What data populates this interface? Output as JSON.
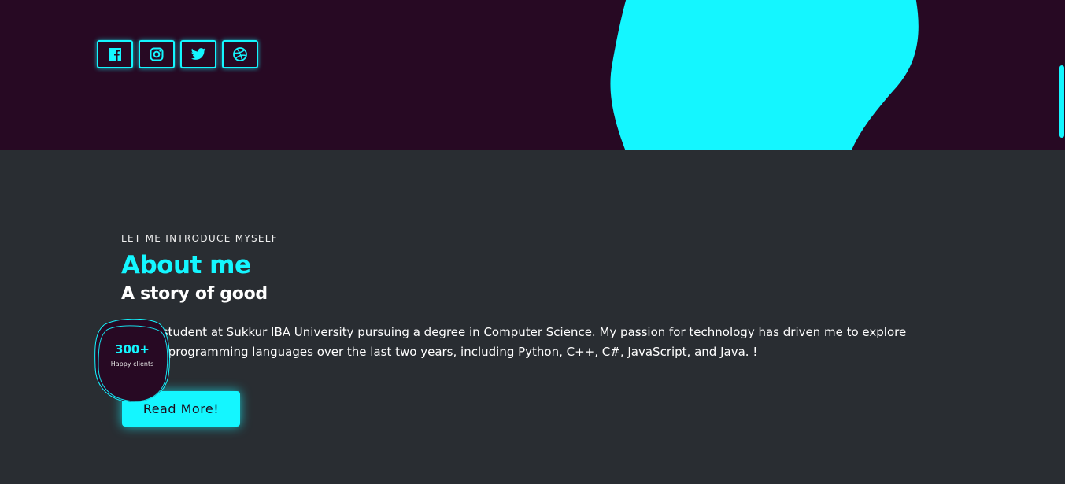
{
  "colors": {
    "accent": "#14f6ff",
    "hero_bg": "#270923",
    "section_bg": "#292d32"
  },
  "hero": {
    "socials": [
      {
        "name": "facebook-icon"
      },
      {
        "name": "instagram-icon"
      },
      {
        "name": "twitter-icon"
      },
      {
        "name": "dribbble-icon"
      }
    ]
  },
  "about": {
    "eyebrow": "LET ME INTRODUCE MYSELF",
    "title": "About me",
    "subtitle": "A story of good",
    "paragraph": "I am a student at Sukkur IBA University pursuing a degree in Computer Science. My passion for technology has driven me to explore various programming languages over the last two years, including Python, C++, C#, JavaScript, and Java. !",
    "cta_label": "Read More!"
  },
  "badge": {
    "count": "300+",
    "label": "Happy clients"
  }
}
